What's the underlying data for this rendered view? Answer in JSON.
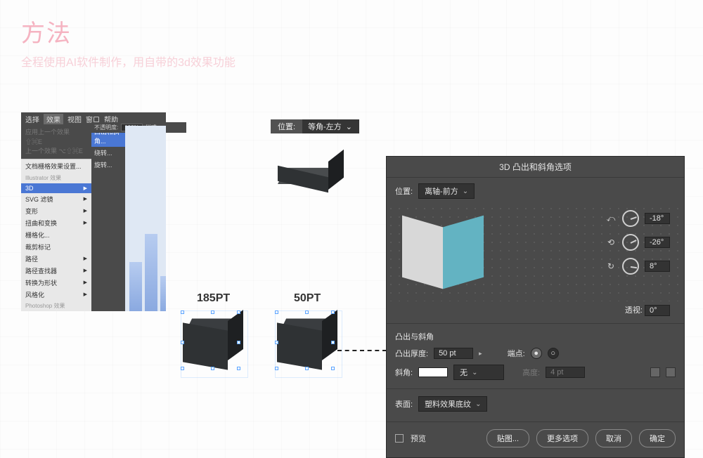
{
  "heading": {
    "title": "方法",
    "subtitle": "全程使用AI软件制作，用自带的3d效果功能"
  },
  "ai_menu": {
    "bar": [
      "选择",
      "效果",
      "视图",
      "窗口",
      "帮助"
    ],
    "top_dim": [
      "应用上一个效果  ⇧⌘E",
      "上一个效果      ⌥⇧⌘E"
    ],
    "doc_raster": "文档栅格效果设置...",
    "group1_head": "Illustrator 效果",
    "group1": [
      "3D",
      "SVG 滤镜",
      "变形",
      "扭曲和变换",
      "栅格化...",
      "裁剪标记",
      "路径",
      "路径查找器",
      "转换为形状",
      "风格化"
    ],
    "group2_head": "Photoshop 效果",
    "submenu": [
      "凸出和斜角...",
      "绕转...",
      "旋转..."
    ],
    "opacity_label": "不透明度:",
    "opacity_value": "100%",
    "style_label": "样式:"
  },
  "mid": {
    "pos_label": "位置:",
    "pos_value": "等角-左方",
    "size1": "185PT",
    "size2": "50PT"
  },
  "dialog": {
    "title": "3D 凸出和斜角选项",
    "pos_label": "位置:",
    "pos_value": "离轴-前方",
    "axis": [
      {
        "icon": "⤺",
        "value": "-18°"
      },
      {
        "icon": "⟲",
        "value": "-26°"
      },
      {
        "icon": "↻",
        "value": "8°"
      }
    ],
    "perspective_label": "透视:",
    "perspective_value": "0°",
    "extrude_head": "凸出与斜角",
    "depth_label": "凸出厚度:",
    "depth_value": "50 pt",
    "cap_label": "端点:",
    "bevel_label": "斜角:",
    "bevel_value": "无",
    "height_label": "高度:",
    "height_value": "4 pt",
    "surface_label": "表面:",
    "surface_value": "塑料效果底纹",
    "preview": "预览",
    "map": "贴图...",
    "more": "更多选项",
    "cancel": "取消",
    "ok": "确定"
  }
}
